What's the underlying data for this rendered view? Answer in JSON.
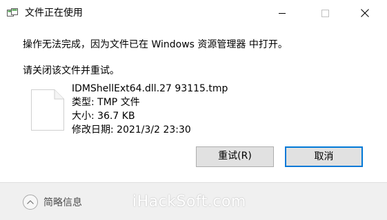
{
  "window": {
    "title": "文件正在使用",
    "icons": {
      "app": "file-in-use-icon",
      "minimize": "minimize-icon",
      "maximize": "maximize-icon",
      "close": "close-icon"
    }
  },
  "content": {
    "message": "操作无法完成，因为文件已在 Windows 资源管理器 中打开。",
    "instruction": "请关闭该文件并重试。",
    "file": {
      "icon": "document-icon",
      "name": "IDMShellExt64.dll.27 93115.tmp",
      "type": "类型: TMP 文件",
      "size": "大小: 36.7 KB",
      "modified": "修改日期: 2021/3/2 23:30"
    }
  },
  "buttons": {
    "retry": "重试(R)",
    "cancel": "取消"
  },
  "footer": {
    "details_label": "简略信息",
    "details_icon": "chevron-up-icon",
    "watermark": "iHackSoft.com"
  },
  "colors": {
    "accent": "#0078d7",
    "button_bg": "#e1e1e1",
    "footer_bg": "#f0f0f0"
  }
}
